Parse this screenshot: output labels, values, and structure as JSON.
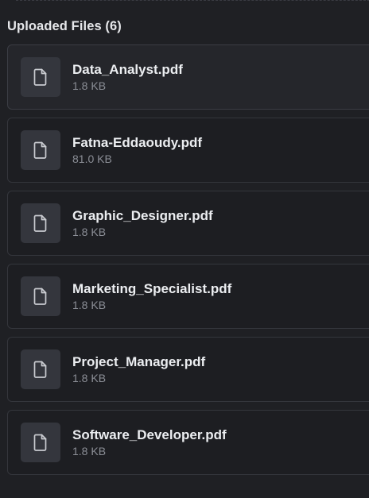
{
  "uploads": {
    "title": "Uploaded Files (6)",
    "files": [
      {
        "name": "Data_Analyst.pdf",
        "size": "1.8 KB",
        "icon": "file-icon"
      },
      {
        "name": "Fatna-Eddaoudy.pdf",
        "size": "81.0 KB",
        "icon": "file-icon"
      },
      {
        "name": "Graphic_Designer.pdf",
        "size": "1.8 KB",
        "icon": "file-icon"
      },
      {
        "name": "Marketing_Specialist.pdf",
        "size": "1.8 KB",
        "icon": "file-icon"
      },
      {
        "name": "Project_Manager.pdf",
        "size": "1.8 KB",
        "icon": "file-icon"
      },
      {
        "name": "Software_Developer.pdf",
        "size": "1.8 KB",
        "icon": "file-icon"
      }
    ]
  },
  "colors": {
    "background": "#1f2024",
    "card_background": "#1d1e22",
    "card_selected_background": "#25262b",
    "card_border": "#34363c",
    "icon_box": "#34363d",
    "icon_stroke": "#c9cbd0",
    "title_text": "#e6e7ea",
    "name_text": "#eceef1",
    "size_text": "#8b8e96"
  }
}
